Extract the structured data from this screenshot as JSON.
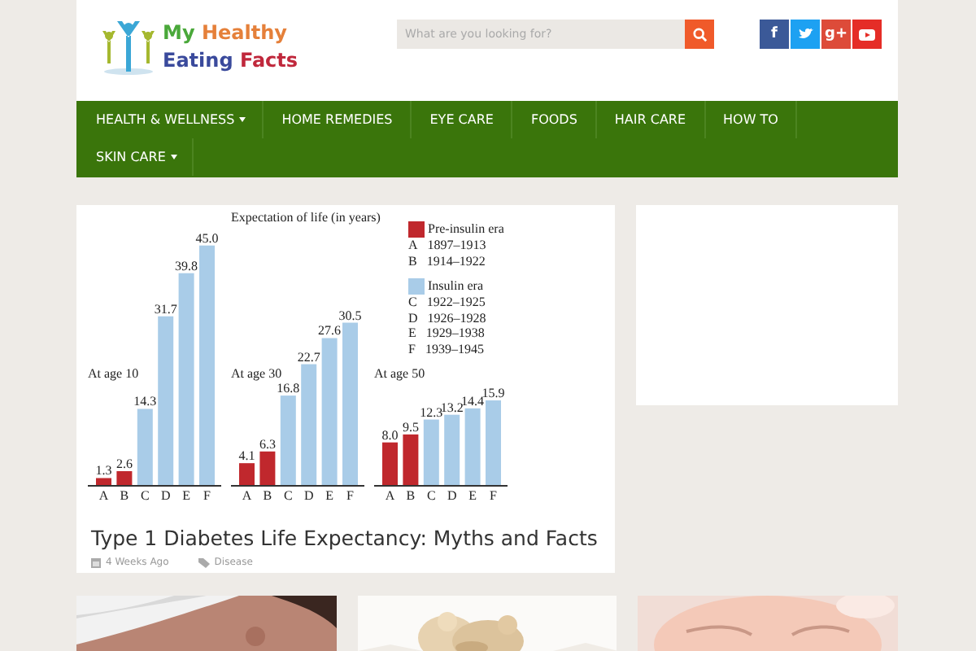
{
  "header": {
    "logo": {
      "lines": [
        [
          {
            "text": "My",
            "color": "#4aa83a"
          },
          {
            "text": "Healthy",
            "color": "#e5803a"
          }
        ],
        [
          {
            "text": "Eating",
            "color": "#3a4a9c"
          },
          {
            "text": "Facts",
            "color": "#c0283c"
          }
        ]
      ]
    },
    "search": {
      "placeholder": "What are you looking for?"
    },
    "social": [
      {
        "kind": "glyph",
        "text": "f",
        "color": "#3b5998"
      },
      {
        "kind": "bird",
        "color": "#1da1f2"
      },
      {
        "kind": "glyph",
        "text": "g+",
        "color": "#dd4b39"
      },
      {
        "kind": "play",
        "color": "#e52d27"
      }
    ]
  },
  "nav": {
    "items": [
      {
        "label": "HEALTH & WELLNESS",
        "has_menu": true
      },
      {
        "label": "HOME REMEDIES",
        "has_menu": false
      },
      {
        "label": "EYE CARE",
        "has_menu": false
      },
      {
        "label": "FOODS",
        "has_menu": false
      },
      {
        "label": "HAIR CARE",
        "has_menu": false
      },
      {
        "label": "HOW TO",
        "has_menu": false
      },
      {
        "label": "SKIN CARE",
        "has_menu": true
      }
    ]
  },
  "post": {
    "figure": {
      "title": "Expectation of life (in years)",
      "legend": [
        {
          "entries": [
            {
              "letter": "A",
              "years": "1897–1913"
            },
            {
              "letter": "B",
              "years": "1914–1922"
            }
          ]
        },
        {
          "entries": [
            {
              "letter": "C",
              "years": "1922–1925"
            },
            {
              "letter": "D",
              "years": "1926–1928"
            },
            {
              "letter": "E",
              "years": "1929–1938"
            },
            {
              "letter": "F",
              "years": "1939–1945"
            }
          ]
        }
      ],
      "panels": [
        {
          "chart_data": {
            "type": "bar",
            "title": "At age 10",
            "categories": [
              "A",
              "B",
              "C",
              "D",
              "E",
              "F"
            ],
            "series": [
              {
                "name": "Pre-insulin era",
                "color": "#c0282d",
                "values": [
                  1.3,
                  2.6,
                  null,
                  null,
                  null,
                  null
                ],
                "value_labels": [
                  "1.3",
                  "2.6",
                  null,
                  null,
                  null,
                  null
                ]
              },
              {
                "name": "Insulin era",
                "color": "#a9cce8",
                "values": [
                  null,
                  null,
                  14.3,
                  31.7,
                  39.8,
                  45.0
                ],
                "value_labels": [
                  null,
                  null,
                  "14.3",
                  "31.7",
                  "39.8",
                  "45.0"
                ]
              }
            ]
          }
        },
        {
          "chart_data": {
            "type": "bar",
            "title": "At age 30",
            "categories": [
              "A",
              "B",
              "C",
              "D",
              "E",
              "F"
            ],
            "series": [
              {
                "color": "#c0282d",
                "values": [
                  4.1,
                  6.3,
                  null,
                  null,
                  null,
                  null
                ],
                "value_labels": [
                  "4.1",
                  "6.3",
                  null,
                  null,
                  null,
                  null
                ]
              },
              {
                "color": "#a9cce8",
                "values": [
                  null,
                  null,
                  16.8,
                  22.7,
                  27.6,
                  30.5
                ],
                "value_labels": [
                  null,
                  null,
                  "16.8",
                  "22.7",
                  "27.6",
                  "30.5"
                ]
              }
            ]
          }
        },
        {
          "chart_data": {
            "type": "bar",
            "title": "At age 50",
            "categories": [
              "A",
              "B",
              "C",
              "D",
              "E",
              "F"
            ],
            "series": [
              {
                "color": "#c0282d",
                "values": [
                  8.0,
                  9.5,
                  null,
                  null,
                  null,
                  null
                ],
                "value_labels": [
                  "8.0",
                  "9.5",
                  null,
                  null,
                  null,
                  null
                ]
              },
              {
                "color": "#a9cce8",
                "values": [
                  null,
                  null,
                  12.3,
                  13.2,
                  14.4,
                  15.9
                ],
                "value_labels": [
                  null,
                  null,
                  "12.3",
                  "13.2",
                  "14.4",
                  "15.9"
                ]
              }
            ]
          }
        }
      ]
    },
    "title": "Type 1 Diabetes Life Expectancy: Myths and Facts",
    "time": "4 Weeks Ago",
    "category": "Disease"
  }
}
